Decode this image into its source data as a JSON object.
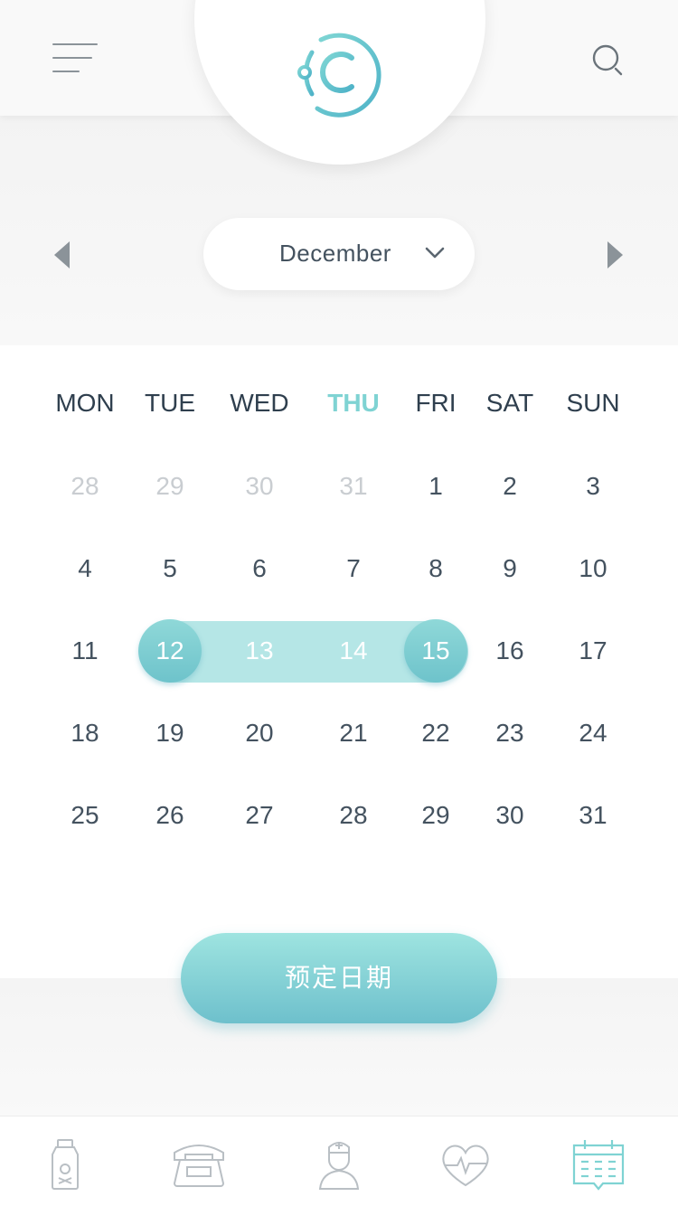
{
  "header": {
    "menu_icon": "menu-icon",
    "search_icon": "search-icon",
    "logo_icon": "logo-icon"
  },
  "month_picker": {
    "month": "December",
    "prev_icon": "triangle-left-icon",
    "next_icon": "triangle-right-icon",
    "dropdown_icon": "chevron-down-icon"
  },
  "calendar": {
    "weekdays": [
      "MON",
      "TUE",
      "WED",
      "THU",
      "FRI",
      "SAT",
      "SUN"
    ],
    "active_weekday": "THU",
    "weeks": [
      [
        "28",
        "29",
        "30",
        "31",
        "1",
        "2",
        "3"
      ],
      [
        "4",
        "5",
        "6",
        "7",
        "8",
        "9",
        "10"
      ],
      [
        "11",
        "12",
        "13",
        "14",
        "15",
        "16",
        "17"
      ],
      [
        "18",
        "19",
        "20",
        "21",
        "22",
        "23",
        "24"
      ],
      [
        "25",
        "26",
        "27",
        "28",
        "29",
        "30",
        "31"
      ]
    ],
    "selected_range": [
      "12",
      "15"
    ]
  },
  "book_button": {
    "label": "预定日期"
  },
  "tabbar": {
    "tabs": [
      "medicine-bottle-icon",
      "telephone-icon",
      "doctor-icon",
      "heart-rate-icon",
      "calendar-icon"
    ],
    "active_tab": "calendar-icon"
  },
  "colors": {
    "accent": "#7fd3d3",
    "range": "#b5e6e6",
    "text": "#44525f",
    "muted": "#c9cdd1"
  }
}
